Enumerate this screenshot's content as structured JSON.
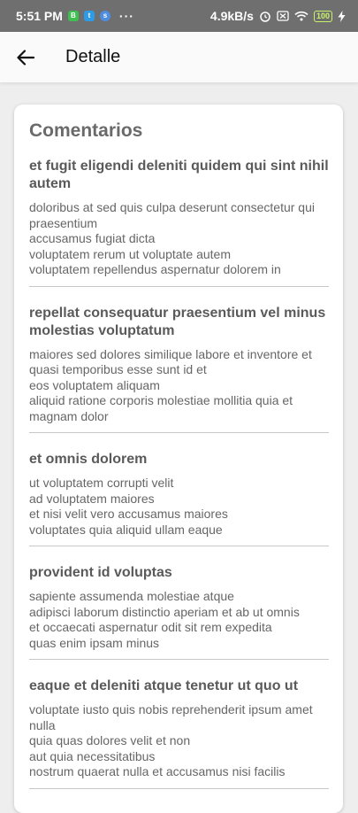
{
  "status_bar": {
    "time": "5:51 PM",
    "speed": "4.9kB/s",
    "battery": "100"
  },
  "app_bar": {
    "title": "Detalle",
    "back_icon": "arrow-left-icon"
  },
  "card": {
    "title": "Comentarios",
    "comments": [
      {
        "title": "et fugit eligendi deleniti quidem qui sint nihil autem",
        "body": "doloribus at sed quis culpa deserunt consectetur qui praesentium\naccusamus fugiat dicta\nvoluptatem rerum ut voluptate autem\nvoluptatem repellendus aspernatur dolorem in"
      },
      {
        "title": "repellat consequatur praesentium vel minus molestias voluptatum",
        "body": "maiores sed dolores similique labore et inventore et\nquasi temporibus esse sunt id et\neos voluptatem aliquam\naliquid ratione corporis molestiae mollitia quia et magnam dolor"
      },
      {
        "title": "et omnis dolorem",
        "body": "ut voluptatem corrupti velit\nad voluptatem maiores\net nisi velit vero accusamus maiores\nvoluptates quia aliquid ullam eaque"
      },
      {
        "title": "provident id voluptas",
        "body": "sapiente assumenda molestiae atque\nadipisci laborum distinctio aperiam et ab ut omnis\net occaecati aspernatur odit sit rem expedita\nquas enim ipsam minus"
      },
      {
        "title": "eaque et deleniti atque tenetur ut quo ut",
        "body": "voluptate iusto quis nobis reprehenderit ipsum amet nulla\nquia quas dolores velit et non\naut quia necessitatibus\nnostrum quaerat nulla et accusamus nisi facilis"
      }
    ]
  }
}
